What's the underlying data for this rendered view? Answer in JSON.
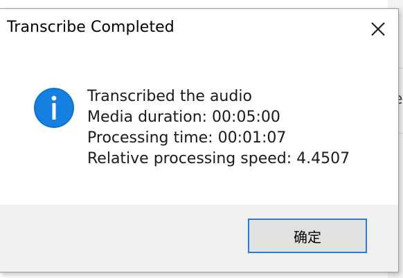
{
  "dialog": {
    "title": "Transcribe Completed",
    "message": {
      "line1": "Transcribed the audio",
      "line2": "Media duration: 00:05:00",
      "line3": "Processing time: 00:01:07",
      "line4": "Relative processing speed: 4.4507"
    },
    "ok_label": "确定",
    "icons": {
      "info": "info-icon",
      "close": "close-icon"
    },
    "colors": {
      "info_icon": "#0a74d4",
      "button_focus_border": "#2a7ad6",
      "footer_bg": "#f0f0f0"
    }
  },
  "background_window": {
    "partial_text": "e"
  }
}
